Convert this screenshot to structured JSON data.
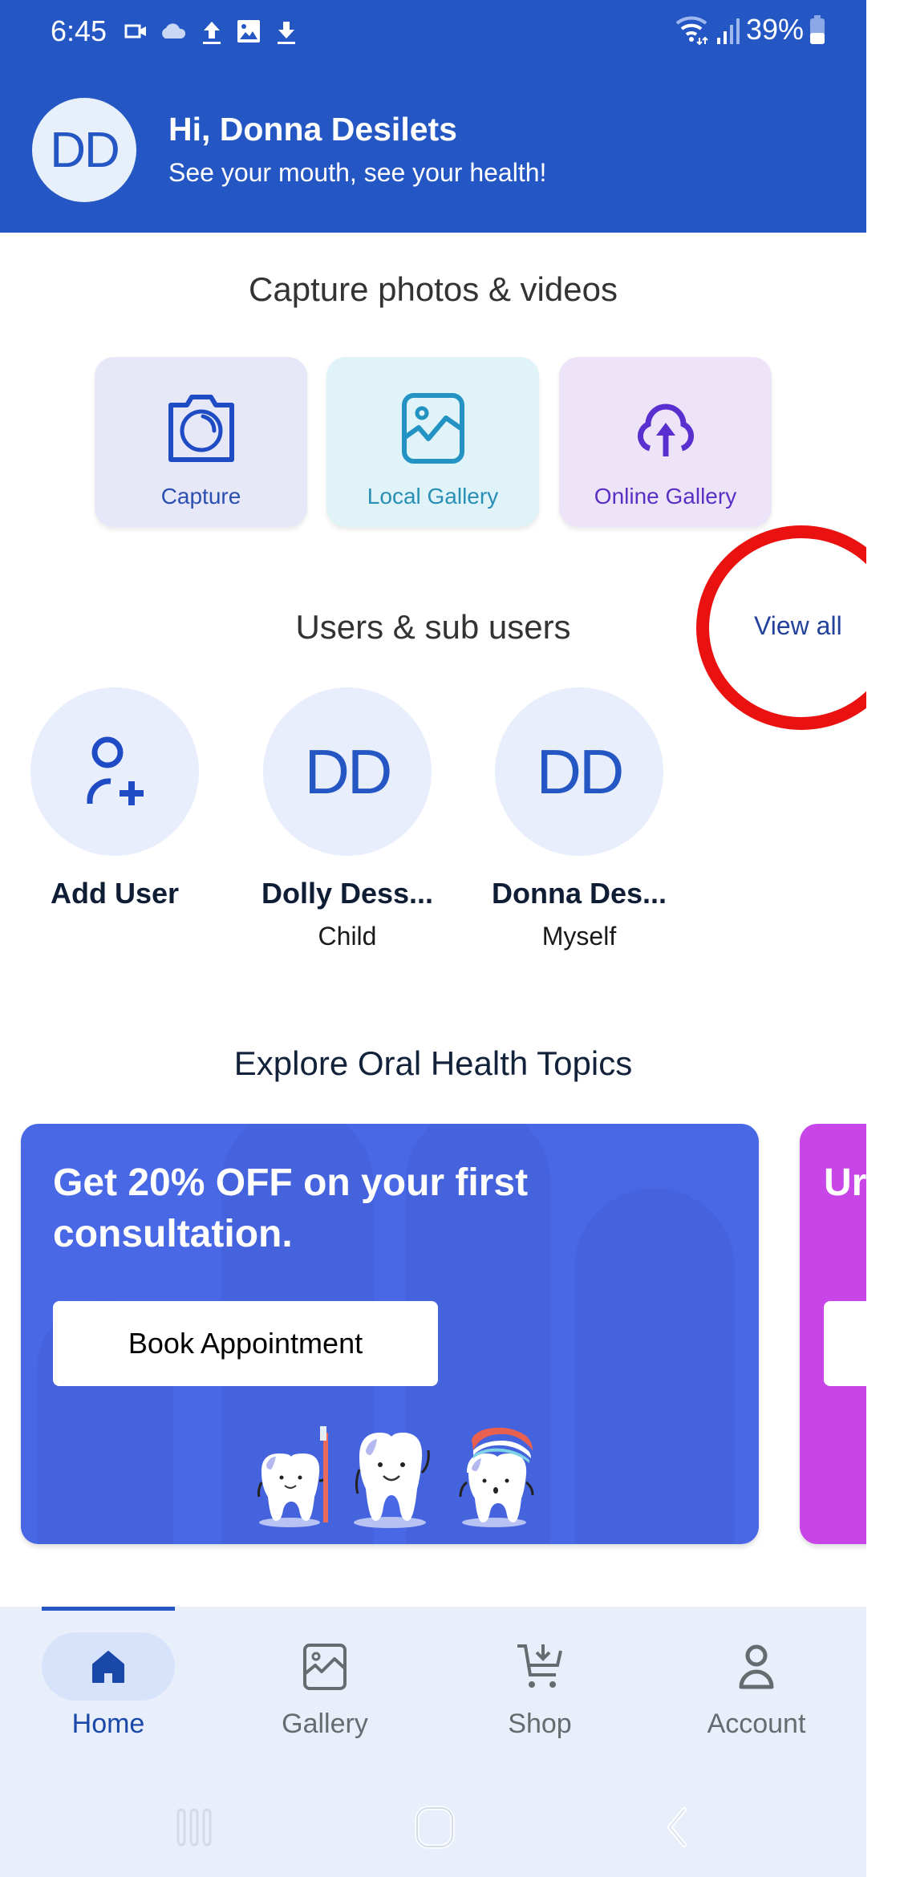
{
  "status_bar": {
    "time": "6:45",
    "left_icons": [
      "video-camera-icon",
      "cloud-icon",
      "upload-icon",
      "image-icon",
      "download-icon"
    ],
    "right_icons": [
      "wifi-icon",
      "signal-icon",
      "battery-icon"
    ],
    "battery": "39%"
  },
  "header": {
    "avatar_initials": "DD",
    "greeting": "Hi, Donna Desilets",
    "tagline": "See your mouth, see your health!"
  },
  "capture_section": {
    "title": "Capture photos & videos",
    "cards": [
      {
        "label": "Capture",
        "icon": "camera-icon",
        "color": "#2a4fb0"
      },
      {
        "label": "Local Gallery",
        "icon": "image-icon",
        "color": "#2a8fb5"
      },
      {
        "label": "Online Gallery",
        "icon": "cloud-upload-icon",
        "color": "#5a2fc4"
      }
    ]
  },
  "users_section": {
    "title": "Users & sub users",
    "view_all": "View all",
    "users": [
      {
        "name": "Add User",
        "role": "",
        "icon": "add-user-icon"
      },
      {
        "name": "Dolly Dess...",
        "role": "Child",
        "initials": "DD"
      },
      {
        "name": "Donna Des...",
        "role": "Myself",
        "initials": "DD"
      }
    ]
  },
  "topics_section": {
    "title": "Explore Oral Health Topics",
    "promos": [
      {
        "title": "Get 20% OFF on your first consultation.",
        "button": "Book Appointment",
        "color": "#4868e6"
      },
      {
        "title": "Ur yo",
        "button": "",
        "color": "#c846e8"
      }
    ]
  },
  "bottom_nav": {
    "items": [
      {
        "label": "Home",
        "icon": "home-icon",
        "active": true
      },
      {
        "label": "Gallery",
        "icon": "gallery-icon",
        "active": false
      },
      {
        "label": "Shop",
        "icon": "cart-download-icon",
        "active": false
      },
      {
        "label": "Account",
        "icon": "person-icon",
        "active": false
      }
    ]
  },
  "system_nav": [
    "recent-apps-icon",
    "home-button-icon",
    "back-icon"
  ],
  "colors": {
    "primary": "#2557c4",
    "annotation": "#ea1111"
  }
}
